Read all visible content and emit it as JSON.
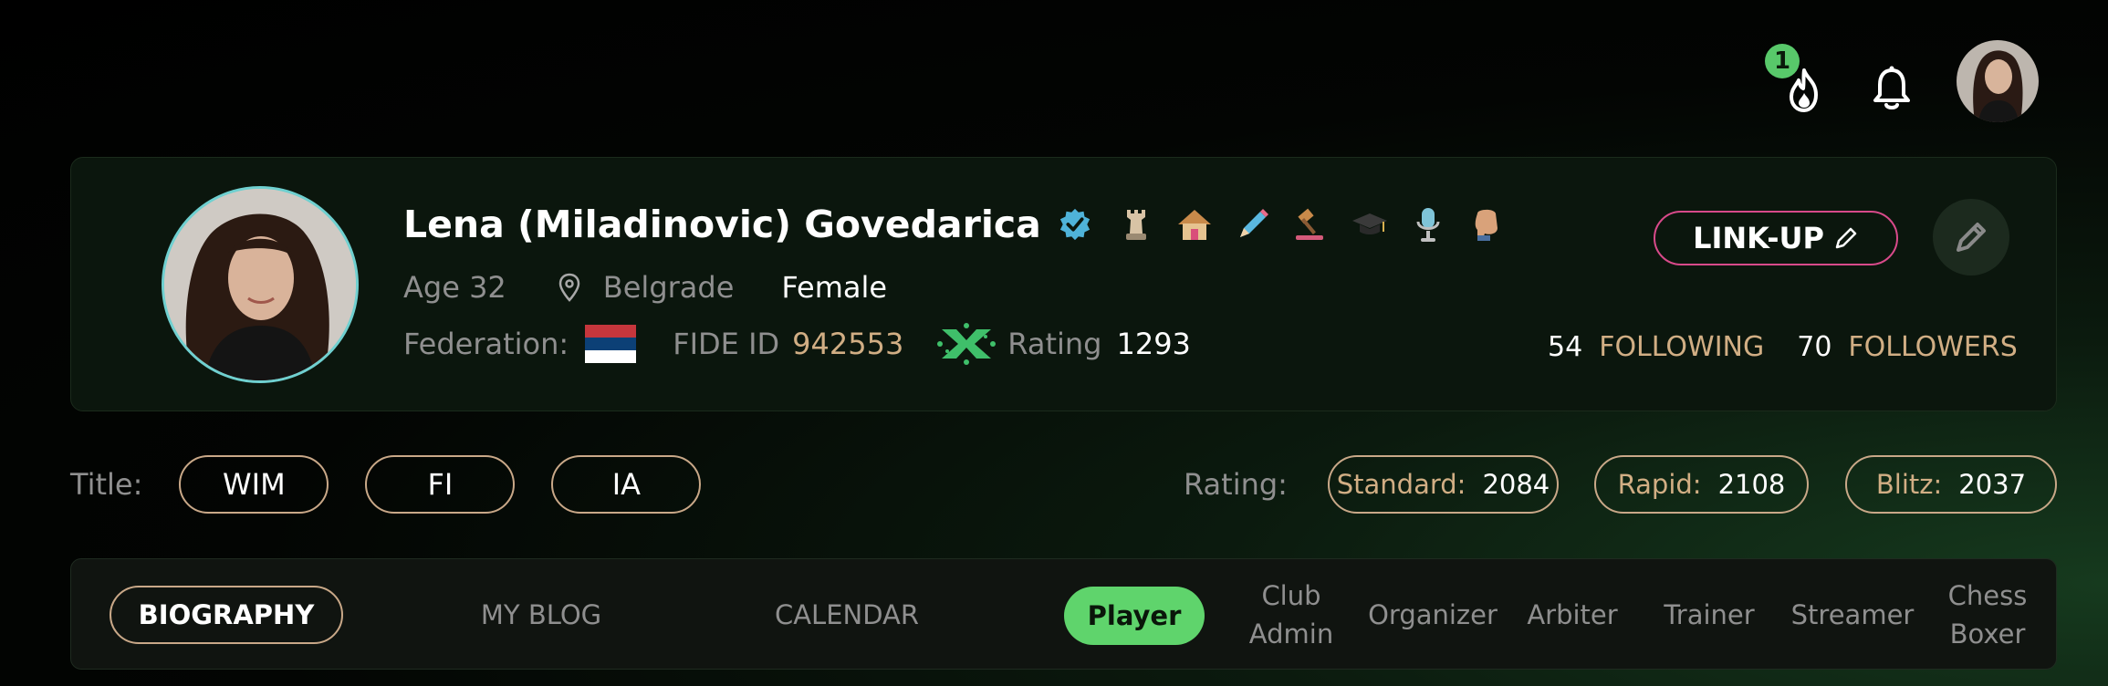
{
  "topbar": {
    "notification_count": "1"
  },
  "profile": {
    "name": "Lena (Miladinovic) Govedarica",
    "age": "Age 32",
    "city": "Belgrade",
    "gender": "Female",
    "federation_label": "Federation:",
    "fide_label": "FIDE ID",
    "fide_id": "942553",
    "rating_label": "Rating",
    "rating": "1293",
    "role_icons": [
      "chess-rook-icon",
      "house-icon",
      "pencil-icon",
      "gavel-icon",
      "graduation-cap-icon",
      "microphone-icon",
      "boxing-icon"
    ],
    "linkup_label": "LINK-UP",
    "following_count": "54",
    "following_label": "FOLLOWING",
    "followers_count": "70",
    "followers_label": "FOLLOWERS",
    "colors": {
      "verified": "#4fb3d9",
      "linkup_border": "#d84a8a",
      "gold": "#d1ae84"
    }
  },
  "titles": {
    "label": "Title:",
    "items": [
      "WIM",
      "FI",
      "IA"
    ]
  },
  "ratings": {
    "label": "Rating:",
    "standard_label": "Standard:",
    "standard_value": "2084",
    "rapid_label": "Rapid:",
    "rapid_value": "2108",
    "blitz_label": "Blitz:",
    "blitz_value": "2037"
  },
  "tabs": {
    "biography": "BIOGRAPHY",
    "blog": "MY BLOG",
    "calendar": "CALENDAR",
    "player": "Player",
    "club_admin": "Club Admin",
    "organizer": "Organizer",
    "arbiter": "Arbiter",
    "trainer": "Trainer",
    "streamer": "Streamer",
    "chess_boxer": "Chess Boxer"
  }
}
